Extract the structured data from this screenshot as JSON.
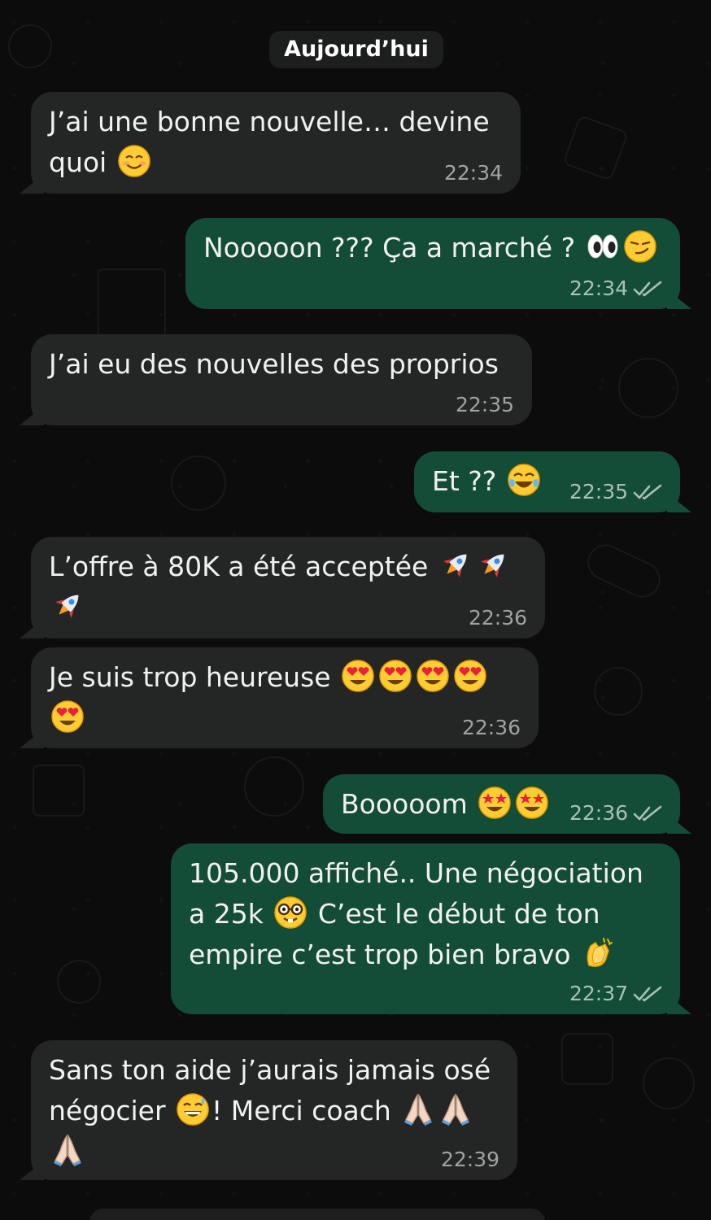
{
  "date_label": "Aujourd’hui",
  "colors": {
    "incoming_bubble": "#242626",
    "outgoing_bubble": "#144d37",
    "background": "#0c0c0c",
    "read_ticks": "#a7c2b4"
  },
  "messages": [
    {
      "direction": "in",
      "text_a": "J’ai une bonne nouvelle… devine",
      "text_b": "quoi",
      "emojis": [
        "smiling-face-emoji"
      ],
      "time": "22:34"
    },
    {
      "direction": "out",
      "text_a": "Nooooon ??? Ça a marché ?",
      "emojis": [
        "eyes-emoji",
        "smirk-emoji"
      ],
      "time": "22:34",
      "status": "read"
    },
    {
      "direction": "in",
      "text_a": "J’ai eu des nouvelles des proprios",
      "time": "22:35"
    },
    {
      "direction": "out",
      "text_a": "Et ??",
      "emojis": [
        "tears-of-joy-emoji"
      ],
      "time": "22:35",
      "status": "read"
    },
    {
      "direction": "in",
      "text_a": "L’offre à 80K a été acceptée",
      "emojis": [
        "rocket-emoji",
        "rocket-emoji",
        "rocket-emoji"
      ],
      "time": "22:36"
    },
    {
      "direction": "in",
      "text_a": "Je suis trop heureuse",
      "emojis": [
        "heart-eyes-emoji",
        "heart-eyes-emoji",
        "heart-eyes-emoji",
        "heart-eyes-emoji",
        "heart-eyes-emoji"
      ],
      "time": "22:36"
    },
    {
      "direction": "out",
      "text_a": "Booooom",
      "emojis": [
        "star-struck-emoji",
        "star-struck-emoji"
      ],
      "time": "22:36",
      "status": "read"
    },
    {
      "direction": "out",
      "text_a": "105.000 affiché.. Une négociation",
      "text_b": "a 25k",
      "text_c": "C’est le début de ton",
      "text_d": "empire c’est trop bien bravo",
      "emojis": [
        "nerd-face-emoji",
        "clapping-hands-emoji"
      ],
      "time": "22:37",
      "status": "read"
    },
    {
      "direction": "in",
      "text_a": "Sans ton aide j’aurais jamais osé",
      "text_b": "négocier",
      "text_c": "! Merci coach",
      "emojis": [
        "grinning-sweat-emoji",
        "folded-hands-emoji",
        "folded-hands-emoji",
        "folded-hands-emoji"
      ],
      "time": "22:39"
    }
  ]
}
